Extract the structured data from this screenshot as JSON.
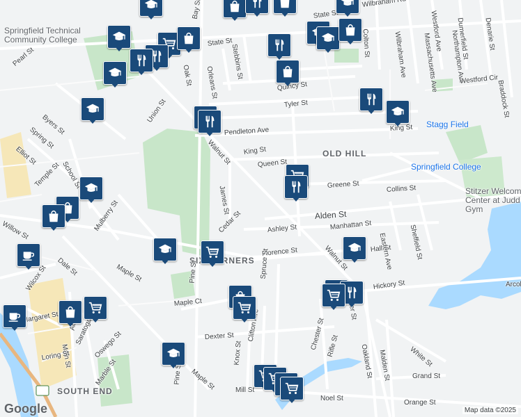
{
  "map": {
    "neighborhoods": [
      "OLD HILL",
      "SIX CORNERS",
      "SOUTH END"
    ],
    "pois": [
      "Springfield Technical Community College",
      "Stagg Field",
      "Springfield College",
      "Stitzer Welcome Center at Judd Gym"
    ],
    "streets": [
      "State St",
      "Wilbraham Rd",
      "Westford Ave",
      "Northampton Ave",
      "Massachusetts Ave",
      "Dumerfield St",
      "Denarie St",
      "Wilbraham Ave",
      "Colton St",
      "Pearl St",
      "Oak St",
      "Orleans St",
      "Stebbins St",
      "Quincy St",
      "Westford Cir",
      "Braddock St",
      "Tyler St",
      "Byers St",
      "Spring St",
      "Elliot St",
      "Union St",
      "Pendleton Ave",
      "King St",
      "School St",
      "Walnut St",
      "Queen St",
      "Temple St",
      "Greene St",
      "Collins St",
      "James St",
      "Mulberry St",
      "Alden St",
      "Willow St",
      "Cedar St",
      "Ashley St",
      "Manhattan St",
      "Dale St",
      "Maple St",
      "Florence St",
      "Hall St",
      "Eastern Ave",
      "Sheffield St",
      "Wilcox St",
      "Pine St",
      "Spruce St",
      "Hickory St",
      "Maple Ct",
      "Margaret St",
      "Adams St",
      "Saratoga St",
      "Main St",
      "Oswego St",
      "Loring St",
      "Marble St",
      "Dexter St",
      "Clifton Ave",
      "Knox St",
      "Chester St",
      "Rifle St",
      "Oakland St",
      "Malden St",
      "White St",
      "Grand St",
      "Mill St",
      "Noel St",
      "Orange St",
      "Arcola St",
      "Bay St"
    ],
    "icons": [
      "education-icon",
      "restaurant-icon",
      "shopping-bag-icon",
      "shopping-cart-icon",
      "cafe-icon"
    ],
    "logo": "Google",
    "attribution": "Map data ©2025"
  },
  "colors": {
    "pin": "#1a4a7a",
    "park": "#c8e6c9",
    "water": "#aadaff",
    "road": "#ffffff"
  }
}
